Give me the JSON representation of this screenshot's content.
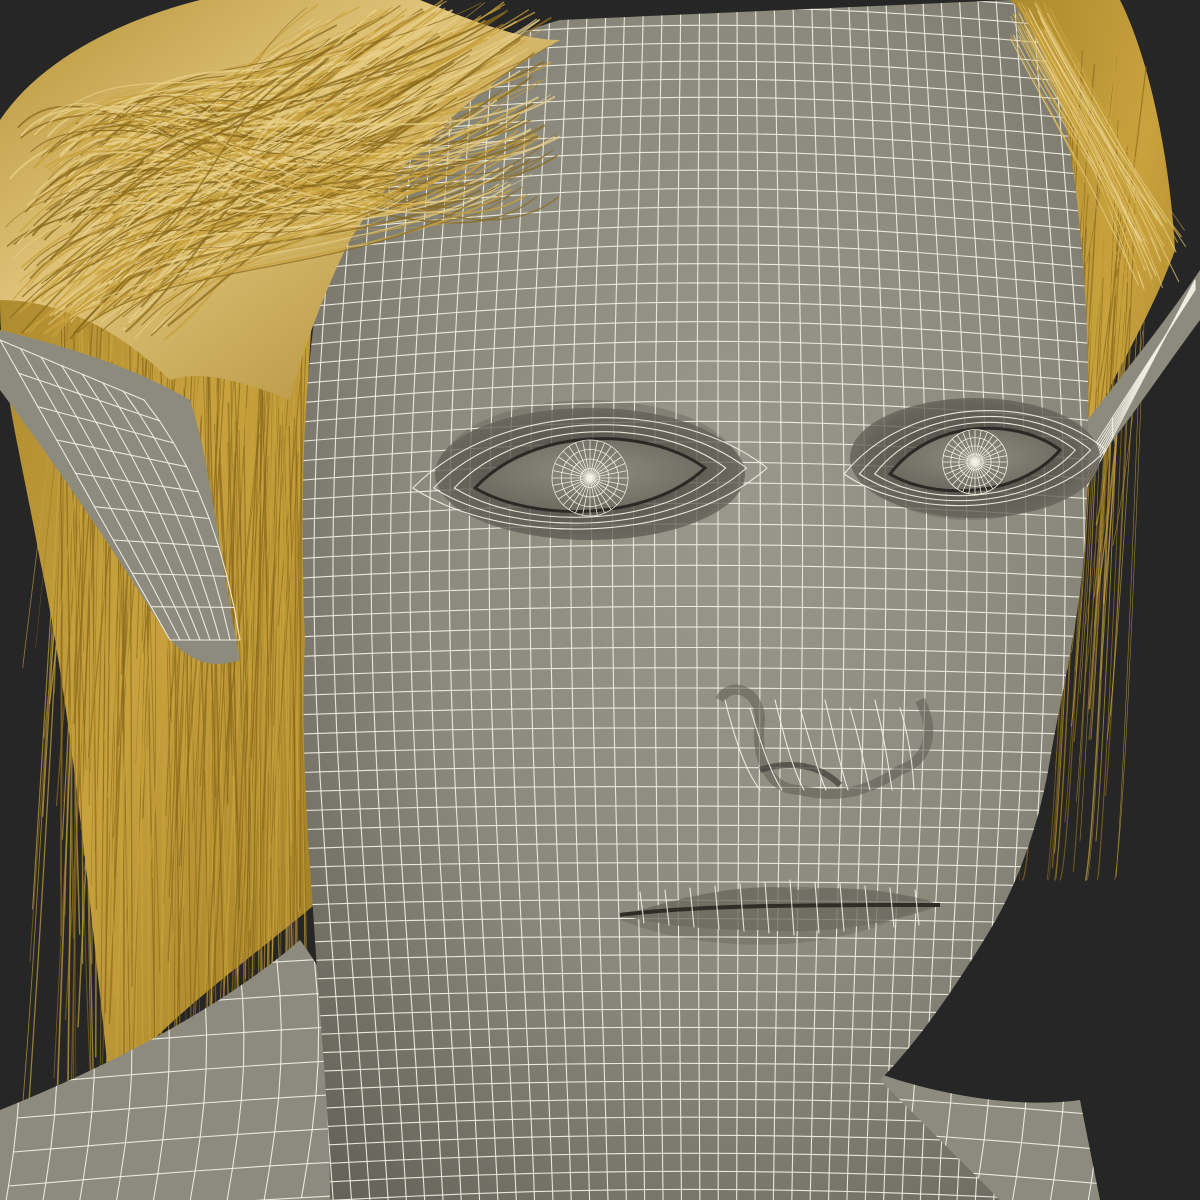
{
  "scene": {
    "background_color": "#262626",
    "skin_color": "#8d8b7e",
    "skin_shadow_color": "#5e5c53",
    "wire_color": "#f2efe4",
    "hair_color": "#c8a23c",
    "hair_highlight_color": "#e8d08a",
    "hair_shadow_color": "#8a6a1c"
  }
}
